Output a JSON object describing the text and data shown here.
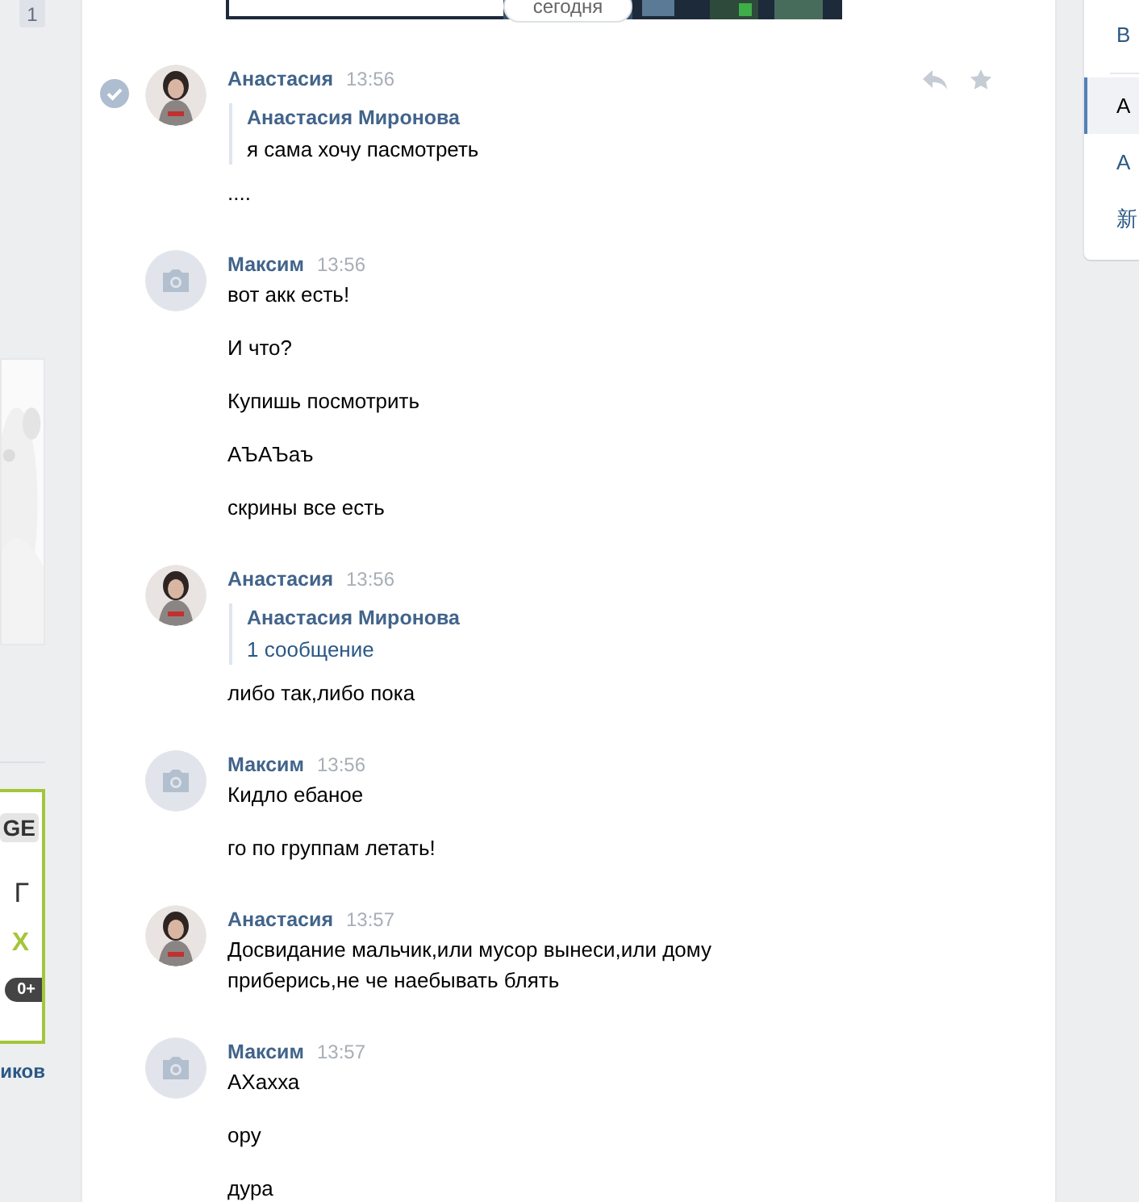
{
  "left_column": {
    "counter": "1",
    "ad": {
      "badge": "GE",
      "line_1": "Г",
      "line_2": "Х",
      "age_rating": "0+"
    },
    "link": "иков"
  },
  "chat": {
    "date_pill": "сегодня",
    "messages": [
      {
        "sender": "Анастасия",
        "time": "13:56",
        "selected": true,
        "actions": true,
        "forwarded": {
          "author": "Анастасия Миронова",
          "text": "я сама хочу пасмотреть",
          "kind": "text"
        },
        "lines": [
          "...."
        ]
      },
      {
        "sender": "Максим",
        "time": "13:56",
        "kind": "camera",
        "selected": false,
        "actions": false,
        "lines": [
          "вот акк есть!",
          "И что?",
          "Купишь посмотрить",
          "АЪАЪаъ",
          "скрины все есть"
        ]
      },
      {
        "sender": "Анастасия",
        "time": "13:56",
        "selected": false,
        "actions": false,
        "forwarded": {
          "author": "Анастасия Миронова",
          "text": "1 сообщение",
          "kind": "link"
        },
        "lines": [
          "либо так,либо пока"
        ]
      },
      {
        "sender": "Максим",
        "time": "13:56",
        "kind": "camera",
        "selected": false,
        "actions": false,
        "lines": [
          "Кидло ебаное",
          "го по группам летать!"
        ]
      },
      {
        "sender": "Анастасия",
        "time": "13:57",
        "selected": false,
        "actions": false,
        "lines": [
          "Досвидание мальчик,или мусор вынеси,или дому приберись,не че наебывать блять"
        ]
      },
      {
        "sender": "Максим",
        "time": "13:57",
        "kind": "camera",
        "selected": false,
        "actions": false,
        "lines": [
          "АХахха",
          "ору",
          "дура"
        ]
      }
    ]
  },
  "right_menu": {
    "top_item": "В",
    "items": [
      {
        "label": "А",
        "selected": true
      },
      {
        "label": "А",
        "selected": false
      },
      {
        "label": "新",
        "selected": false
      }
    ]
  }
}
